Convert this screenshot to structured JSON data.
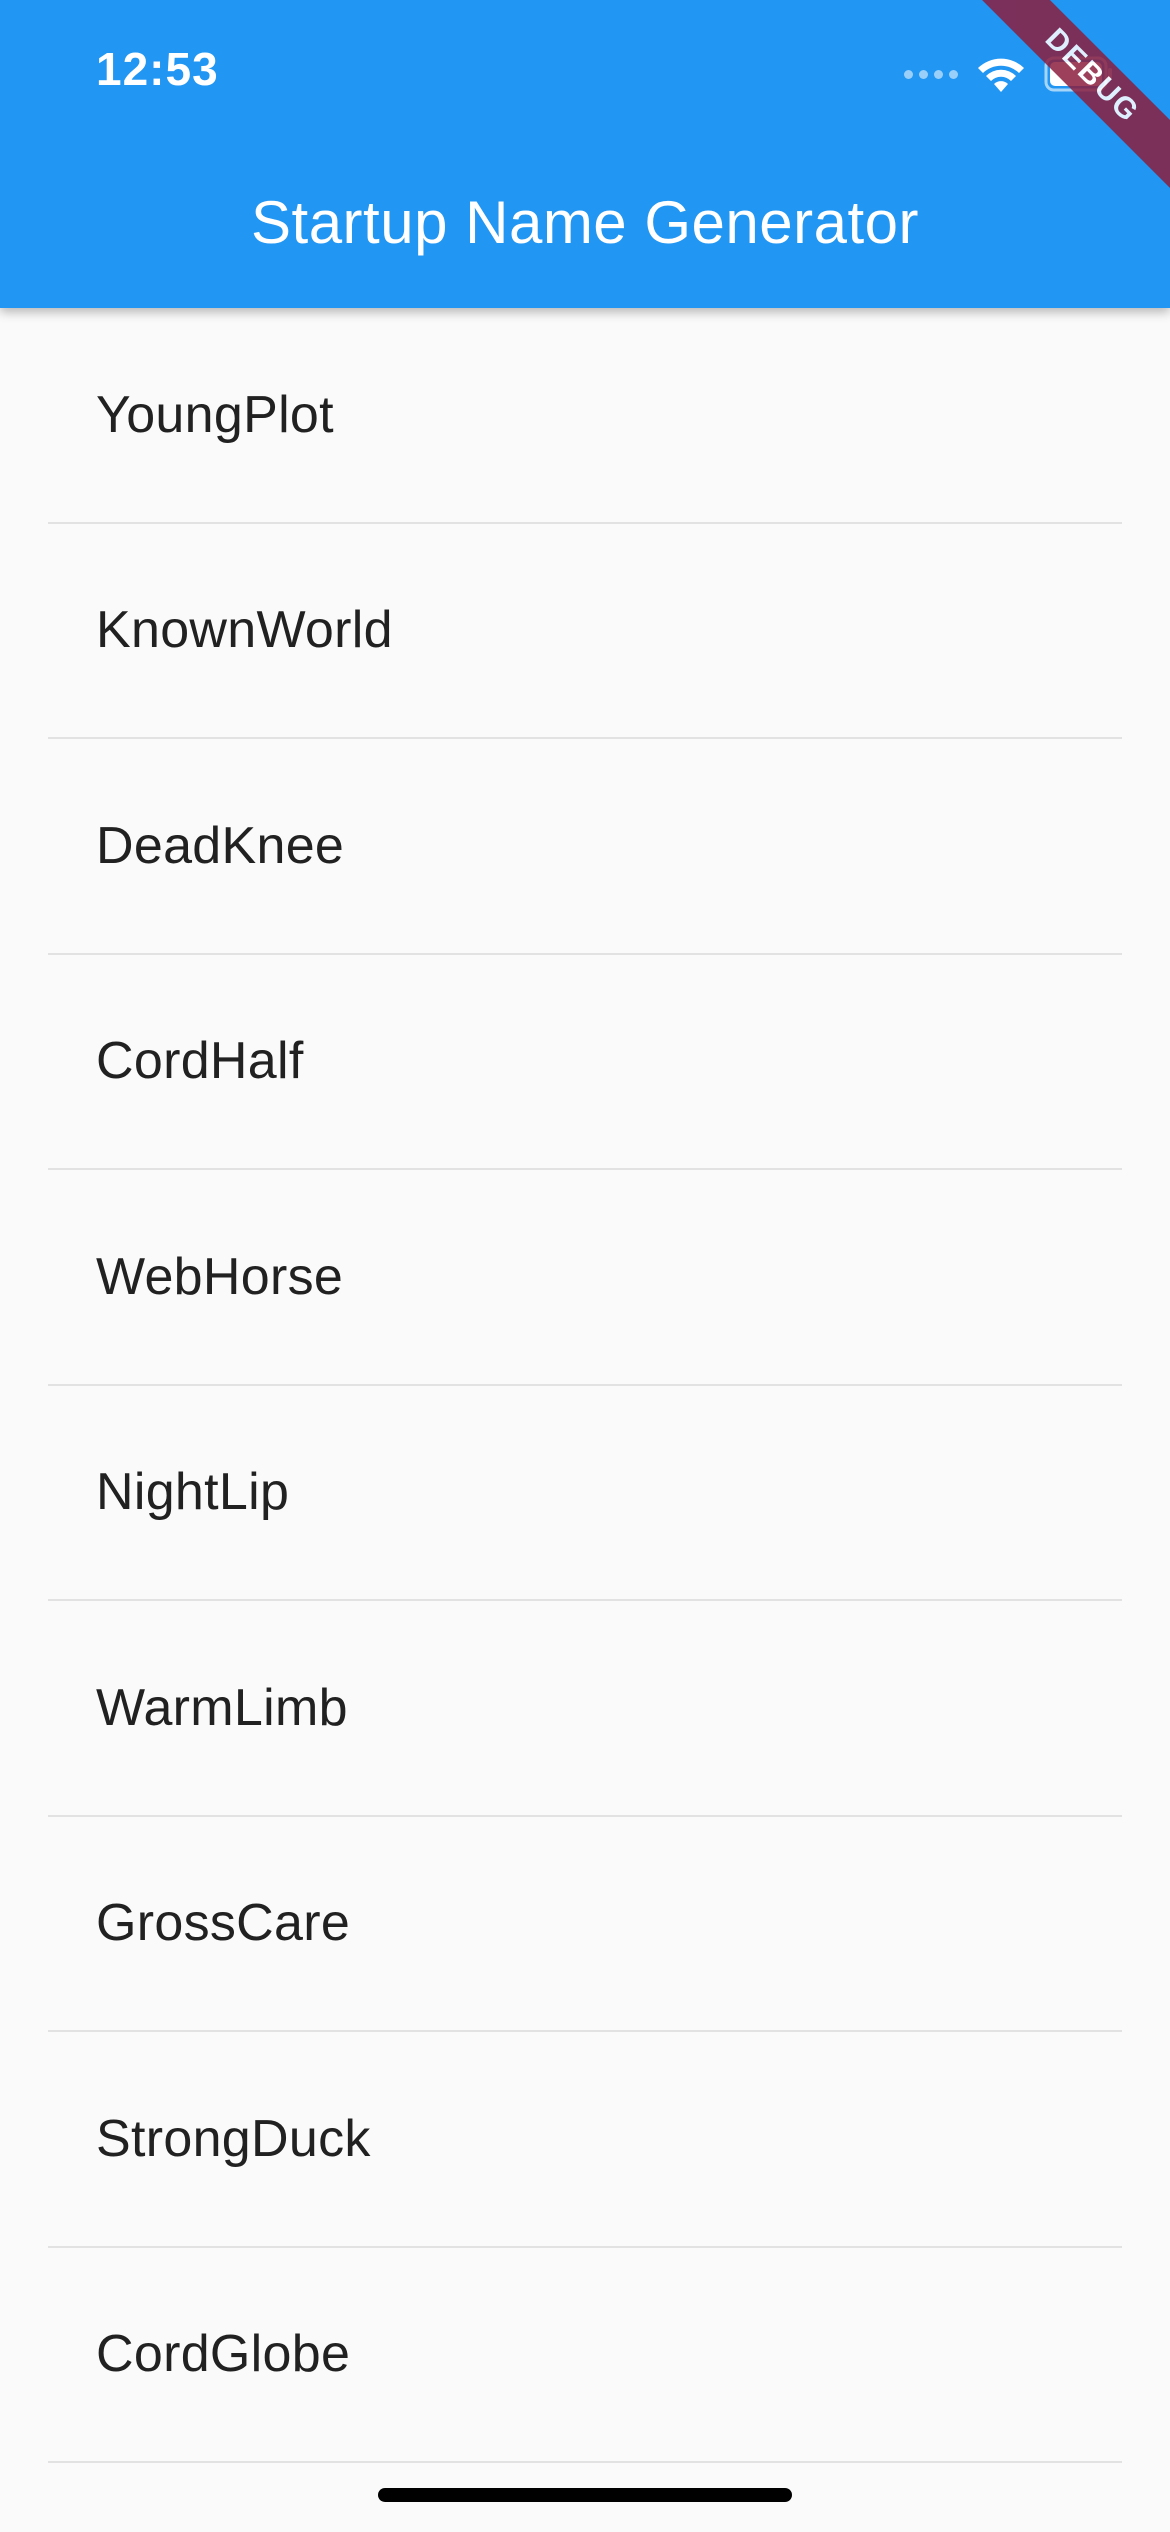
{
  "status_bar": {
    "time": "12:53",
    "signal_icon": "cellular-signal-icon",
    "wifi_icon": "wifi-icon",
    "battery_icon": "battery-icon"
  },
  "app_bar": {
    "title": "Startup Name Generator",
    "color": "#2196f3"
  },
  "debug_banner": {
    "label": "DEBUG",
    "color": "#8b1f3f"
  },
  "list": {
    "items": [
      "YoungPlot",
      "KnownWorld",
      "DeadKnee",
      "CordHalf",
      "WebHorse",
      "NightLip",
      "WarmLimb",
      "GrossCare",
      "StrongDuck",
      "CordGlobe"
    ]
  }
}
